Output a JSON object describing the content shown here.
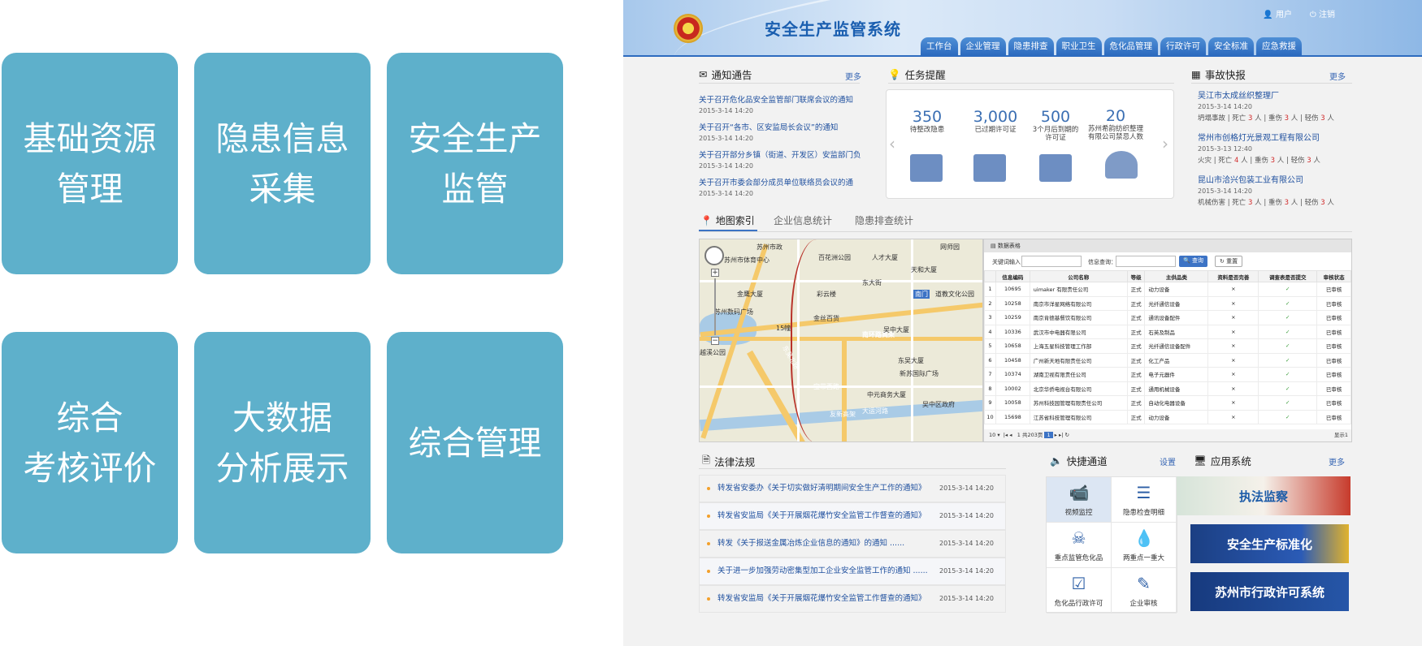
{
  "tiles": [
    {
      "label": "基础资源\n管理"
    },
    {
      "label": "隐患信息\n采集"
    },
    {
      "label": "安全生产\n监管"
    },
    {
      "label": "综合\n考核评价"
    },
    {
      "label": "大数据\n分析展示"
    },
    {
      "label": "综合管理"
    }
  ],
  "header": {
    "title": "安全生产监管系统",
    "user_label": "用户",
    "logout_label": "注销",
    "nav": [
      "工作台",
      "企业管理",
      "隐患排查",
      "职业卫生",
      "危化品管理",
      "行政许可",
      "安全标准",
      "应急救援"
    ]
  },
  "notices": {
    "title": "通知通告",
    "more": "更多",
    "items": [
      {
        "text": "关于召开危化品安全监管部门联席会议的通知",
        "date": "2015-3-14 14:20"
      },
      {
        "text": "关于召开“各市、区安监局长会议”的通知",
        "date": "2015-3-14 14:20"
      },
      {
        "text": "关于召开部分乡镇（街道、开发区）安监部门负",
        "date": "2015-3-14 14:20"
      },
      {
        "text": "关于召开市委会部分成员单位联络员会议的通",
        "date": "2015-3-14 14:20"
      }
    ]
  },
  "tasks": {
    "title": "任务提醒",
    "items": [
      {
        "value": "350",
        "label": "待整改隐患"
      },
      {
        "value": "3,000",
        "label": "已过期许可证"
      },
      {
        "value": "500",
        "label": "3个月后到期的\n许可证"
      },
      {
        "value": "20",
        "label": "苏州希韵纺织整理\n有限公司禁忌人数"
      }
    ]
  },
  "accidents": {
    "title": "事故快报",
    "more": "更多",
    "items": [
      {
        "company": "吴江市太成丝织整理厂",
        "date": "2015-3-14 14:20",
        "type": "坍塌事故",
        "death": "3",
        "severe": "3",
        "minor": "3"
      },
      {
        "company": "常州市创格灯光景观工程有限公司",
        "date": "2015-3-13 12:40",
        "type": "火灾",
        "death": "4",
        "severe": "3",
        "minor": "3"
      },
      {
        "company": "昆山市洽兴包装工业有限公司",
        "date": "2015-3-14 14:20",
        "type": "机械伤害",
        "death": "3",
        "severe": "3",
        "minor": "3"
      }
    ],
    "death_label": "死亡",
    "severe_label": "重伤",
    "minor_label": "轻伤",
    "unit": "人"
  },
  "tabs": [
    "地图索引",
    "企业信息统计",
    "隐患排查统计"
  ],
  "map": {
    "labels": [
      "苏州市政",
      "苏州市体育中心",
      "百花洲公园",
      "人才大厦",
      "网师园",
      "天和大厦",
      "南门",
      "道教文化公园",
      "金鹰大厦",
      "东大街",
      "苏州数码广场",
      "彩云楼",
      "金丝百货",
      "15幢",
      "南环路高架",
      "吴中大厦",
      "东吴大厦",
      "新苏国际广场",
      "中元商务大厦",
      "吴中区政府",
      "宝带西路",
      "东吴北路",
      "越溪公园",
      "友新高架",
      "大运河路"
    ]
  },
  "grid": {
    "title": "数据表格",
    "keyword_label": "关键词输入：",
    "info_label": "信息查询：",
    "search_btn": "查询",
    "reset_btn": "重置",
    "columns": [
      "信息编码",
      "公司名称",
      "等级",
      "主供品类",
      "资料是否完善",
      "调查表是否提交",
      "审核状态"
    ],
    "rows": [
      {
        "no": "1",
        "code": "10695",
        "name": "uimaker 有限责任公司",
        "level": "正式",
        "cat": "动力设备",
        "doc": "×",
        "sub": "✓",
        "status": "已审核"
      },
      {
        "no": "2",
        "code": "10258",
        "name": "南京市洋星网络有限公司",
        "level": "正式",
        "cat": "光纤通信设备",
        "doc": "×",
        "sub": "✓",
        "status": "已审核"
      },
      {
        "no": "3",
        "code": "10259",
        "name": "南京肯德基餐饮有限公司",
        "level": "正式",
        "cat": "通讯设备配件",
        "doc": "×",
        "sub": "✓",
        "status": "已审核"
      },
      {
        "no": "4",
        "code": "10336",
        "name": "武汉市中电器有限公司",
        "level": "正式",
        "cat": "石英及制品",
        "doc": "×",
        "sub": "✓",
        "status": "已审核"
      },
      {
        "no": "5",
        "code": "10658",
        "name": "上海五星科技管理工作部",
        "level": "正式",
        "cat": "光纤通信设备配件",
        "doc": "×",
        "sub": "✓",
        "status": "已审核"
      },
      {
        "no": "6",
        "code": "10458",
        "name": "广州新天地有限责任公司",
        "level": "正式",
        "cat": "化工产品",
        "doc": "×",
        "sub": "✓",
        "status": "已审核"
      },
      {
        "no": "7",
        "code": "10374",
        "name": "湖南卫视有限责任公司",
        "level": "正式",
        "cat": "电子元器件",
        "doc": "×",
        "sub": "✓",
        "status": "已审核"
      },
      {
        "no": "8",
        "code": "10002",
        "name": "北京华侨电视台有限公司",
        "level": "正式",
        "cat": "通用机械设备",
        "doc": "×",
        "sub": "✓",
        "status": "已审核"
      },
      {
        "no": "9",
        "code": "10058",
        "name": "苏州科技园管理有限责任公司",
        "level": "正式",
        "cat": "自动化电器设备",
        "doc": "×",
        "sub": "✓",
        "status": "已审核"
      },
      {
        "no": "10",
        "code": "15698",
        "name": "江苏省科技管理有限公司",
        "level": "正式",
        "cat": "动力设备",
        "doc": "×",
        "sub": "✓",
        "status": "已审核"
      }
    ],
    "pager": {
      "page_size": "10",
      "page": "1",
      "total": "共203页",
      "current": "1",
      "display": "显示1"
    }
  },
  "laws": {
    "title": "法律法规",
    "items": [
      {
        "text": "转发省安委办《关于切实做好清明期间安全生产工作的通知》",
        "date": "2015-3-14  14:20"
      },
      {
        "text": "转发省安监局《关于开展烟花爆竹安全监管工作督查的通知》",
        "date": "2015-3-14  14:20"
      },
      {
        "text": "转发《关于报送金属冶炼企业信息的通知》的通知 ......",
        "date": "2015-3-14  14:20"
      },
      {
        "text": "关于进一步加强劳动密集型加工企业安全监管工作的通知 ......",
        "date": "2015-3-14  14:20"
      },
      {
        "text": "转发省安监局《关于开展烟花爆竹安全监管工作督查的通知》",
        "date": "2015-3-14  14:20"
      }
    ]
  },
  "quick": {
    "title": "快捷通道",
    "settings": "设置",
    "items": [
      "视频监控",
      "隐患检查明细",
      "重点监管危化品",
      "两重点一重大",
      "危化品行政许可",
      "企业审核"
    ]
  },
  "apps": {
    "title": "应用系统",
    "more": "更多",
    "banners": [
      "执法监察",
      "安全生产标准化",
      "苏州市行政许可系统"
    ]
  },
  "colors": {
    "tile": "#5eb0cb",
    "accent": "#2d6bbf",
    "link": "#1e4f9e",
    "danger": "#d12a2a"
  }
}
